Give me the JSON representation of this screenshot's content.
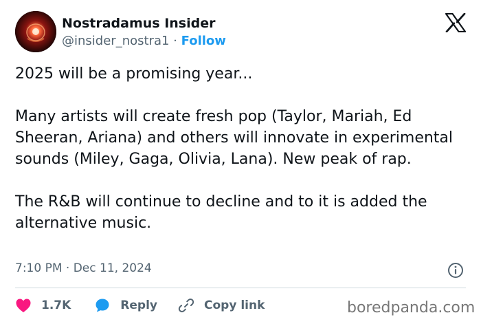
{
  "author": {
    "name": "Nostradamus Insider",
    "handle": "@insider_nostra1",
    "separator": "·",
    "follow_label": "Follow"
  },
  "tweet": {
    "text": "2025 will be a promising year...\n\nMany artists will create fresh pop (Taylor, Mariah, Ed Sheeran, Ariana) and others will innovate in experimental sounds (Miley, Gaga, Olivia, Lana). New peak of rap.\n\nThe R&B will continue to decline and to it is added the alternative music.",
    "time": "7:10 PM",
    "date_separator": "·",
    "date": "Dec 11, 2024"
  },
  "actions": {
    "like_count": "1.7K",
    "reply_label": "Reply",
    "copy_link_label": "Copy link"
  },
  "watermark": "boredpanda.com",
  "icons": {
    "brand": "x-logo-icon",
    "info": "info-icon",
    "like": "heart-icon",
    "reply": "speech-bubble-icon",
    "copy_link": "link-icon"
  },
  "colors": {
    "follow": "#1d9bf0",
    "heart": "#f91880",
    "reply_bubble": "#1d9bf0",
    "secondary_text": "#536471",
    "primary_text": "#0f1419"
  }
}
